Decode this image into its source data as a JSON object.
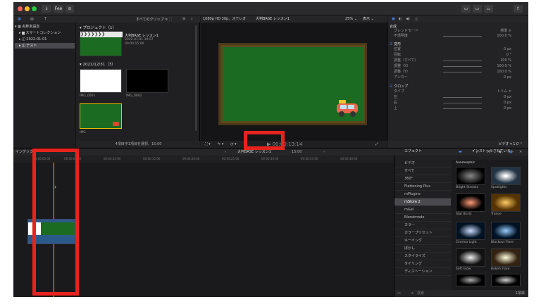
{
  "colors": {
    "red_highlight": "#e8231e",
    "board_green": "#1c6b22",
    "frame_brown": "#5b4a1e",
    "accent_blue": "#3b82f6"
  },
  "titlebar": {
    "buttons": [
      "↓",
      "Fee",
      "⊘"
    ],
    "right_buttons": [
      "▭",
      "▭",
      "▭",
      "⇧"
    ]
  },
  "sidebar": {
    "items": [
      "名称未設定",
      "スマートコレクション",
      "2022-01-01",
      "テスト"
    ]
  },
  "browser": {
    "filter_label": "すべてのクリップ ≑ ⁚ ⁚",
    "project_section": "▾ プロジェクト（1）",
    "project_clip": {
      "title": "大判BASE レッスン1",
      "lines": [
        "2022-01-01 10:07",
        "00:00:15:00"
      ],
      "arrows": "❯❯❯❯❯❯❯"
    },
    "date_section": "▾ 2021/12/31（3）",
    "clips": [
      "IMG_0001",
      "IMG_0002",
      "IMG"
    ],
    "footer": "4項目中1項目を選択、15:00"
  },
  "viewer": {
    "format": "1080p HD 30p、ステレオ",
    "project_name": "大判BASE レッスン1",
    "zoom": "25% ⌄",
    "view": "表示 ⌄",
    "timecode": "▶ 00:00:13:14"
  },
  "inspector": {
    "compositing_header": "合成",
    "blend_mode_label": "ブレンドモード",
    "blend_mode_value": "標準 ≑",
    "opacity_label": "不透明度",
    "opacity_value": "100.0 %",
    "transform_header": "変形",
    "rows": [
      {
        "label": "位置",
        "value": "0 px"
      },
      {
        "label": "回転",
        "value": "0 °"
      },
      {
        "label": "調整（すべて）",
        "value": "100 %"
      },
      {
        "label": "調整（X）",
        "value": "100.0 %"
      },
      {
        "label": "調整（Y）",
        "value": "100.0 %"
      },
      {
        "label": "アンカー",
        "value": "0 px"
      }
    ],
    "crop_header": "クロップ",
    "crop_rows": [
      {
        "label": "タイプ",
        "value": "トリム ≑"
      },
      {
        "label": "左",
        "value": "0 px"
      },
      {
        "label": "右",
        "value": "0 px"
      },
      {
        "label": "上",
        "value": "0 px"
      }
    ],
    "footer": "ビデオ ▾ 1.0 ⌃"
  },
  "timeline": {
    "left_label": "インデックス",
    "project_label": "大判BASE レッスン1",
    "duration": "15:00",
    "ruler": [
      "00:00:00:00",
      "00:00:05:00",
      "00:00:10:00",
      "00:00:15:00",
      "00:00:20:00",
      "00:00:25:00",
      "00:00:30:00",
      "00:00:35:00",
      "00:00:40:00",
      "00:00:45:00",
      "00:00:50:00",
      "00:00:55:00"
    ]
  },
  "effects": {
    "header": "エフェクト",
    "installed": "インストールされている...",
    "categories": [
      "ビデオ",
      "すべて",
      "360°",
      "Flattening Plus",
      "mPlugins",
      "mStore 2",
      "mGel",
      "Blendmode",
      "カラー",
      "カラープリセット",
      "キーイング",
      "ぼかし",
      "スタイライズ",
      "タイリング",
      "ディストーション"
    ],
    "group": "Anamorphic",
    "items": [
      "Anamorphic",
      "Flare",
      "Bright Streaks",
      "Spotlights",
      "Star Burst",
      "Trance",
      "Cinema Light",
      "Blackout Flare",
      "Soft Glow",
      "Bokeh Flare",
      "Lens Glare",
      "Moving Blur"
    ],
    "search_placeholder": "検索",
    "count": "1項目"
  }
}
